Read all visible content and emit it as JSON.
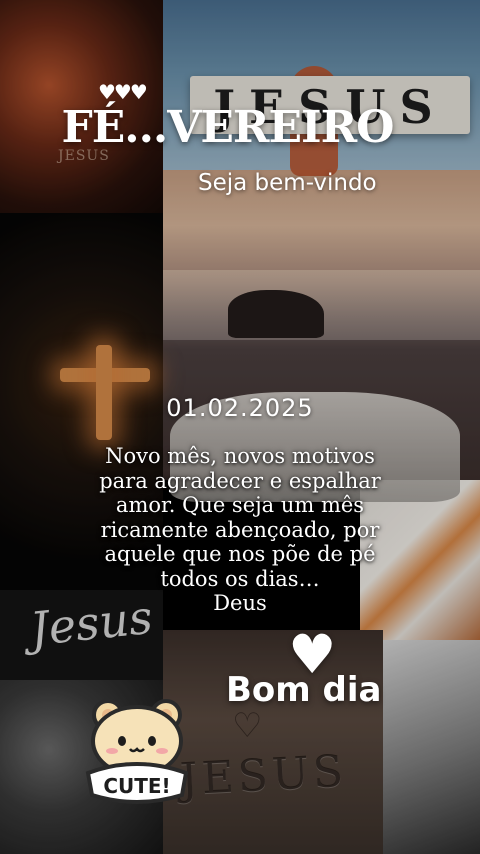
{
  "header": {
    "title": "FÉ...VEREIRO",
    "decoration": "♥♥♥",
    "subtitle": "Seja bem-vindo"
  },
  "background": {
    "sign_text": "JESUS",
    "fire_tile_text": "JESUS",
    "script_text": "Jesus",
    "sand_text": "JESUS",
    "sand_heart": "♡"
  },
  "post": {
    "date": "01.02.2025",
    "message_lines": [
      "Novo mês, novos motivos",
      "para agradecer e espalhar",
      "amor. Que seja um mês",
      "ricamente abençoado, por",
      "aquele que nos põe de pé",
      "todos os dias…",
      "Deus"
    ],
    "heart": "♥",
    "greeting": "Bom dia"
  },
  "sticker": {
    "label": "CUTE!"
  }
}
